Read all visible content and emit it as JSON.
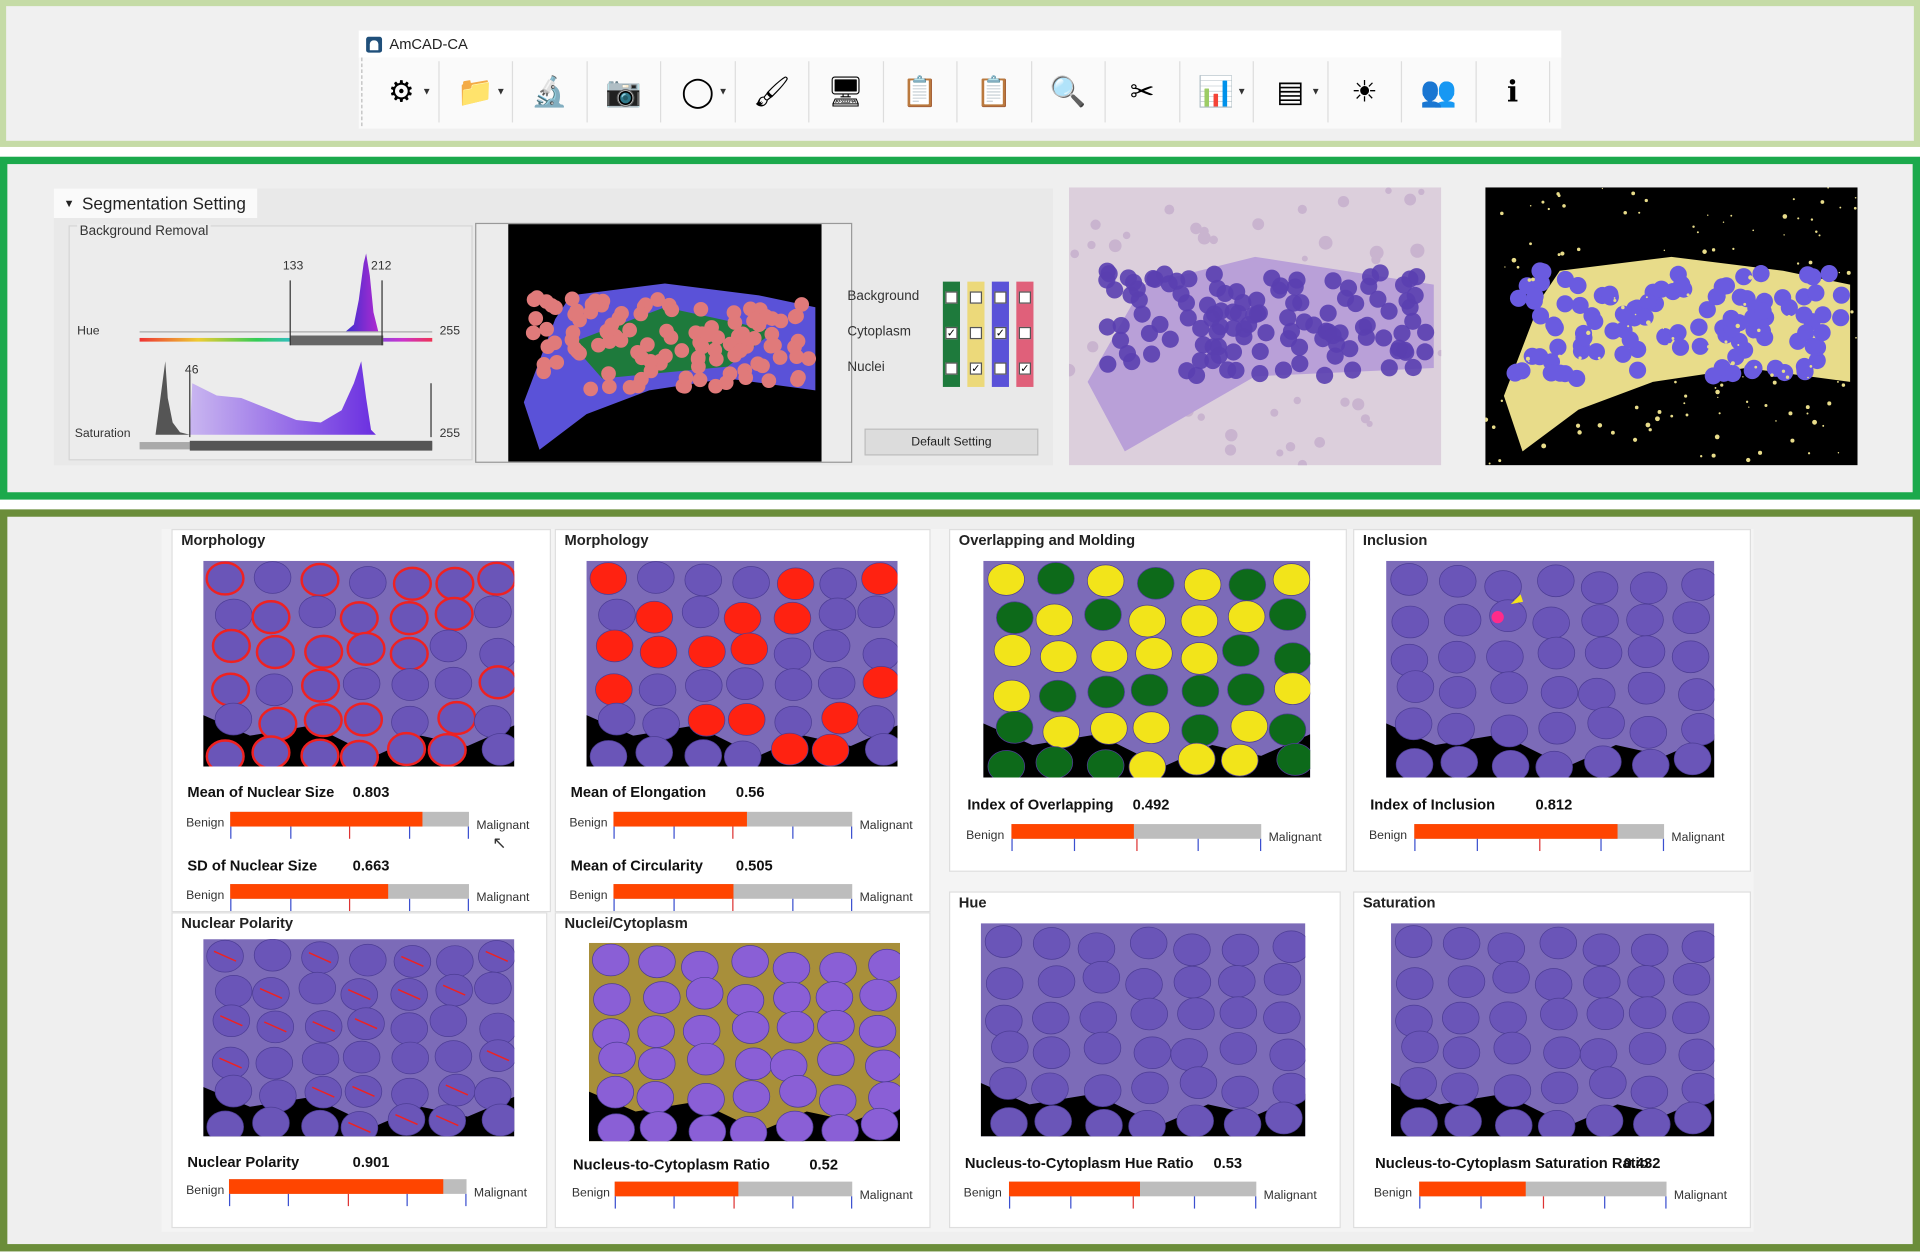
{
  "app": {
    "title": "AmCAD-CA"
  },
  "toolbar": [
    {
      "icon": "settings-gear-icon",
      "dropdown": true,
      "glyph": "⚙"
    },
    {
      "icon": "folder-icon",
      "dropdown": true,
      "glyph": "📁"
    },
    {
      "icon": "microscope-icon",
      "dropdown": false,
      "glyph": "🔬"
    },
    {
      "icon": "camera-icon",
      "dropdown": false,
      "glyph": "📷"
    },
    {
      "icon": "freeform-region-icon",
      "dropdown": true,
      "glyph": "◯"
    },
    {
      "icon": "eraser-brush-icon",
      "dropdown": false,
      "glyph": "🖌"
    },
    {
      "icon": "monitor-waveform-icon",
      "dropdown": false,
      "glyph": "🖥"
    },
    {
      "icon": "clipboard-icon",
      "dropdown": false,
      "glyph": "📋"
    },
    {
      "icon": "clipboard-paste-icon",
      "dropdown": false,
      "glyph": "📋"
    },
    {
      "icon": "magnifier-icon",
      "dropdown": false,
      "glyph": "🔍"
    },
    {
      "icon": "scissors-icon",
      "dropdown": false,
      "glyph": "✂"
    },
    {
      "icon": "histogram-icon",
      "dropdown": true,
      "glyph": "📊"
    },
    {
      "icon": "rgb-color-icon",
      "dropdown": true,
      "glyph": "▤"
    },
    {
      "icon": "brightness-icon",
      "dropdown": false,
      "glyph": "☀"
    },
    {
      "icon": "users-icon",
      "dropdown": false,
      "glyph": "👥"
    },
    {
      "icon": "info-book-icon",
      "dropdown": false,
      "glyph": "ℹ"
    }
  ],
  "segmentation": {
    "title": "Segmentation Setting",
    "group": "Background Removal",
    "hue": {
      "label": "Hue",
      "low": "133",
      "high": "212",
      "max": "255"
    },
    "saturation": {
      "label": "Saturation",
      "low": "46",
      "max": "255"
    },
    "classes": [
      "Background",
      "Cytoplasm",
      "Nuclei"
    ],
    "class_colors": [
      "#1e7a3c",
      "#ecd97a",
      "#5a52d8",
      "#e0607a"
    ],
    "checks": [
      [
        false,
        false,
        false,
        false
      ],
      [
        true,
        false,
        true,
        false
      ],
      [
        false,
        true,
        false,
        true
      ]
    ],
    "default_button": "Default Setting"
  },
  "labels": {
    "benign": "Benign",
    "malignant": "Malignant"
  },
  "panels": [
    {
      "title": "Morphology",
      "metrics": [
        {
          "label": "Mean of Nuclear Size",
          "value": "0.803",
          "fraction": 0.803
        },
        {
          "label": "SD of Nuclear Size",
          "value": "0.663",
          "fraction": 0.663
        }
      ]
    },
    {
      "title": "Morphology",
      "metrics": [
        {
          "label": "Mean of Elongation",
          "value": "0.56",
          "fraction": 0.56
        },
        {
          "label": "Mean of Circularity",
          "value": "0.505",
          "fraction": 0.505
        }
      ]
    },
    {
      "title": "Overlapping and Molding",
      "metrics": [
        {
          "label": "Index of Overlapping",
          "value": "0.492",
          "fraction": 0.492
        }
      ]
    },
    {
      "title": "Inclusion",
      "metrics": [
        {
          "label": "Index of Inclusion",
          "value": "0.812",
          "fraction": 0.812
        }
      ]
    },
    {
      "title": "Nuclear Polarity",
      "metrics": [
        {
          "label": "Nuclear Polarity",
          "value": "0.901",
          "fraction": 0.901
        }
      ]
    },
    {
      "title": "Nuclei/Cytoplasm",
      "metrics": [
        {
          "label": "Nucleus-to-Cytoplasm Ratio",
          "value": "0.52",
          "fraction": 0.52
        }
      ]
    },
    {
      "title": "Hue",
      "metrics": [
        {
          "label": "Nucleus-to-Cytoplasm Hue Ratio",
          "value": "0.53",
          "fraction": 0.53
        }
      ]
    },
    {
      "title": "Saturation",
      "metrics": [
        {
          "label": "Nucleus-to-Cytoplasm Saturation Ratio",
          "value": "0.432",
          "fraction": 0.432
        }
      ]
    }
  ],
  "colors": {
    "bar_fill": "#ff4500",
    "bar_track": "#bdbdbd",
    "tick": "#3b4fcf",
    "tick_mid": "#dd3333"
  }
}
